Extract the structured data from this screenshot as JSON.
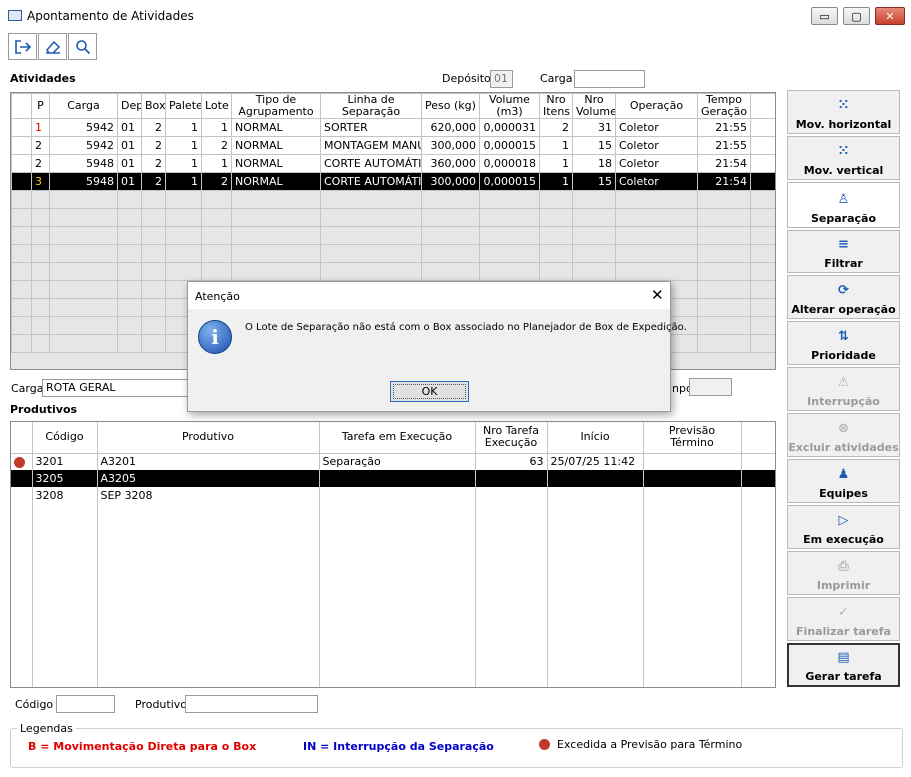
{
  "window": {
    "title": "Apontamento de Atividades",
    "min": "▭",
    "max": "▢",
    "close": "✕"
  },
  "atividades": {
    "label": "Atividades",
    "deposito_label": "Depósito",
    "deposito_value": "01",
    "carga_label": "Carga",
    "carga_value": "",
    "headers": [
      "P",
      "Carga",
      "Dep",
      "Box",
      "Palete",
      "Lote",
      "Tipo de Agrupamento",
      "Linha de Separação",
      "Peso (kg)",
      "Volume (m3)",
      "Nro Itens",
      "Nro Volume",
      "Operação",
      "Tempo Geração"
    ],
    "rows": [
      {
        "p": "1",
        "carga": "5942",
        "dep": "01",
        "box": "2",
        "palete": "1",
        "lote": "1",
        "tipo": "NORMAL",
        "linha": "SORTER",
        "peso": "620,000",
        "volume": "0,000031",
        "itens": "2",
        "nvol": "31",
        "op": "Coletor",
        "tempo": "21:55"
      },
      {
        "p": "2",
        "carga": "5942",
        "dep": "01",
        "box": "2",
        "palete": "1",
        "lote": "2",
        "tipo": "NORMAL",
        "linha": "MONTAGEM MANU",
        "peso": "300,000",
        "volume": "0,000015",
        "itens": "1",
        "nvol": "15",
        "op": "Coletor",
        "tempo": "21:55"
      },
      {
        "p": "2",
        "carga": "5948",
        "dep": "01",
        "box": "2",
        "palete": "1",
        "lote": "1",
        "tipo": "NORMAL",
        "linha": "CORTE AUTOMÁTI",
        "peso": "360,000",
        "volume": "0,000018",
        "itens": "1",
        "nvol": "18",
        "op": "Coletor",
        "tempo": "21:54"
      },
      {
        "p": "3",
        "carga": "5948",
        "dep": "01",
        "box": "2",
        "palete": "1",
        "lote": "2",
        "tipo": "NORMAL",
        "linha": "CORTE AUTOMÁTI",
        "peso": "300,000",
        "volume": "0,000015",
        "itens": "1",
        "nvol": "15",
        "op": "Coletor",
        "tempo": "21:54"
      }
    ]
  },
  "carga_info": {
    "label": "Carga",
    "value": "ROTA GERAL",
    "tempo_label": "npo",
    "tempo_value": ""
  },
  "produtos": {
    "label": "Produtivos",
    "headers": [
      "Código",
      "Produtivo",
      "Tarefa em Execução",
      "Nro Tarefa Execução",
      "Início",
      "Previsão Término"
    ],
    "rows": [
      {
        "codigo": "3201",
        "produtivo": "A3201",
        "tarefa": "Separação",
        "nro": "63",
        "inicio": "25/07/25 11:42",
        "prev": ""
      },
      {
        "codigo": "3205",
        "produtivo": "A3205",
        "tarefa": "",
        "nro": "",
        "inicio": "",
        "prev": ""
      },
      {
        "codigo": "3208",
        "produtivo": "SEP 3208",
        "tarefa": "",
        "nro": "",
        "inicio": "",
        "prev": ""
      }
    ]
  },
  "filters": {
    "codigo_label": "Código",
    "codigo_value": "",
    "produtivo_label": "Produtivo",
    "produtivo_value": ""
  },
  "side": [
    {
      "label": "Mov. horizontal",
      "icon": "⁙"
    },
    {
      "label": "Mov. vertical",
      "icon": "⁙"
    },
    {
      "label": "Separação",
      "icon": "♙"
    },
    {
      "label": "Filtrar",
      "icon": "≡"
    },
    {
      "label": "Alterar operação",
      "icon": "⟳"
    },
    {
      "label": "Prioridade",
      "icon": "⇅"
    },
    {
      "label": "Interrupção",
      "icon": "⚠"
    },
    {
      "label": "Excluir atividades",
      "icon": "⊗"
    },
    {
      "label": "Equipes",
      "icon": "♟"
    },
    {
      "label": "Em execução",
      "icon": "▷"
    },
    {
      "label": "Imprimir",
      "icon": "⎙"
    },
    {
      "label": "Finalizar tarefa",
      "icon": "✓"
    },
    {
      "label": "Gerar tarefa",
      "icon": "▤"
    }
  ],
  "legend": {
    "title": "Legendas",
    "b": "B = Movimentação Direta para o Box",
    "in": "IN = Interrupção da Separação",
    "exc": "Excedida a Previsão para Término",
    "colors": {
      "red": "#e00000",
      "blue": "#0000c8",
      "dot": "#c0392b"
    }
  },
  "dialog": {
    "title": "Atenção",
    "message": "O Lote de Separação não está com o Box associado no Planejador de Box de Expedição.",
    "ok": "OK",
    "icon": "i"
  }
}
